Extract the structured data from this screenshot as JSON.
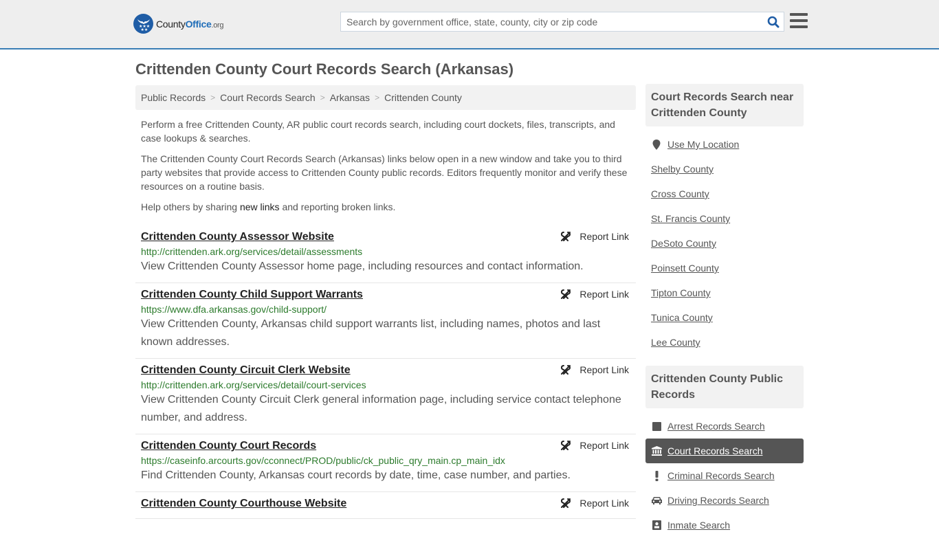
{
  "header": {
    "logo": {
      "brand_county": "County",
      "brand_office": "Office",
      "brand_tld": ".org",
      "icon": "eagle-stars-badge-icon"
    },
    "search": {
      "placeholder": "Search by government office, state, county, city or zip code",
      "value": "",
      "icon": "search-icon"
    },
    "menu_icon": "hamburger-menu-icon",
    "colors": {
      "brand_blue": "#1f5da6",
      "header_bg": "#eeeeee",
      "header_border": "#3a7eb5"
    }
  },
  "page": {
    "title": "Crittenden County Court Records Search (Arkansas)"
  },
  "breadcrumb": [
    {
      "label": "Public Records"
    },
    {
      "label": "Court Records Search"
    },
    {
      "label": "Arkansas"
    },
    {
      "label": "Crittenden County"
    }
  ],
  "intro": {
    "p1": "Perform a free Crittenden County, AR public court records search, including court dockets, files, transcripts, and case lookups & searches.",
    "p2": "The Crittenden County Court Records Search (Arkansas) links below open in a new window and take you to third party websites that provide access to Crittenden County public records. Editors frequently monitor and verify these resources on a routine basis.",
    "p3_before": "Help others by sharing ",
    "p3_link": "new links",
    "p3_after": " and reporting broken links."
  },
  "results": [
    {
      "title": "Crittenden County Assessor Website",
      "url": "http://crittenden.ark.org/services/detail/assessments",
      "description": "View Crittenden County Assessor home page, including resources and contact information.",
      "report_label": "Report Link"
    },
    {
      "title": "Crittenden County Child Support Warrants",
      "url": "https://www.dfa.arkansas.gov/child-support/",
      "description": "View Crittenden County, Arkansas child support warrants list, including names, photos and last known addresses.",
      "report_label": "Report Link"
    },
    {
      "title": "Crittenden County Circuit Clerk Website",
      "url": "http://crittenden.ark.org/services/detail/court-services",
      "description": "View Crittenden County Circuit Clerk general information page, including service contact telephone number, and address.",
      "report_label": "Report Link"
    },
    {
      "title": "Crittenden County Court Records",
      "url": "https://caseinfo.arcourts.gov/cconnect/PROD/public/ck_public_qry_main.cp_main_idx",
      "description": "Find Crittenden County, Arkansas court records by date, time, case number, and parties.",
      "report_label": "Report Link"
    },
    {
      "title": "Crittenden County Courthouse Website",
      "url": "",
      "description": "",
      "report_label": "Report Link"
    }
  ],
  "sidebar": {
    "nearby": {
      "heading": "Court Records Search near Crittenden County",
      "use_location": "Use My Location",
      "counties": [
        "Shelby County",
        "Cross County",
        "St. Francis County",
        "DeSoto County",
        "Poinsett County",
        "Tipton County",
        "Tunica County",
        "Lee County"
      ]
    },
    "public_records": {
      "heading": "Crittenden County Public Records",
      "items": [
        {
          "label": "Arrest Records Search",
          "icon": "square-icon",
          "active": false
        },
        {
          "label": "Court Records Search",
          "icon": "courthouse-icon",
          "active": true
        },
        {
          "label": "Criminal Records Search",
          "icon": "exclamation-icon",
          "active": false
        },
        {
          "label": "Driving Records Search",
          "icon": "car-icon",
          "active": false
        },
        {
          "label": "Inmate Search",
          "icon": "inmate-icon",
          "active": false
        }
      ]
    }
  }
}
